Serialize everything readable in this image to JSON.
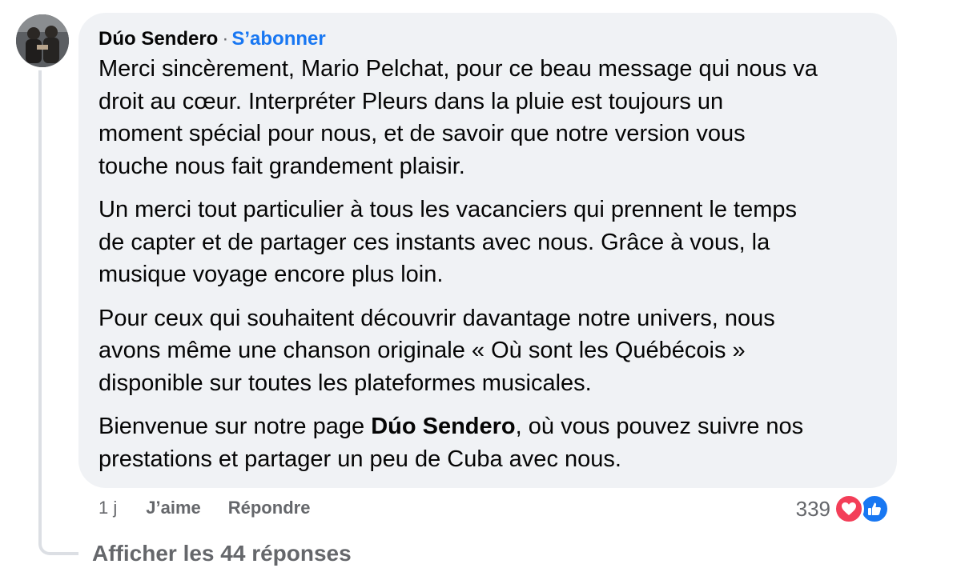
{
  "comment": {
    "author": "Dúo Sendero",
    "separator": "·",
    "follow_label": "S’abonner",
    "paragraphs": {
      "p1": "Merci sincèrement, Mario Pelchat, pour ce beau message qui nous va",
      "p1b": "droit au cœur. Interpréter Pleurs dans la pluie est toujours un",
      "p1c": "moment spécial pour nous, et de savoir que notre version vous",
      "p1d": "touche nous fait grandement plaisir.",
      "p2": "Un merci tout particulier à tous les vacanciers qui prennent le temps",
      "p2b": "de capter et de partager ces instants avec nous. Grâce à vous, la",
      "p2c": "musique voyage encore plus loin.",
      "p3": "Pour ceux qui souhaitent découvrir davantage notre univers, nous",
      "p3b": "avons même une chanson originale « Où sont les Québécois »",
      "p3c": "disponible sur toutes les plateformes musicales.",
      "p4_pre": "Bienvenue sur notre page ",
      "p4_bold": "Dúo Sendero",
      "p4_post": ", où vous pouvez suivre nos",
      "p4b": "prestations et partager un peu de Cuba avec nous."
    }
  },
  "actions": {
    "time": "1 j",
    "like_label": "J’aime",
    "reply_label": "Répondre"
  },
  "reactions": {
    "count": "339",
    "icons": [
      "heart-icon",
      "thumbs-up-icon"
    ],
    "colors": {
      "love": "#f33e58",
      "like": "#1877f2"
    }
  },
  "replies": {
    "label": "Afficher les 44 réponses"
  },
  "colors": {
    "bubble": "#f0f2f5",
    "link": "#1877f2",
    "secondary_text": "#65676b"
  }
}
